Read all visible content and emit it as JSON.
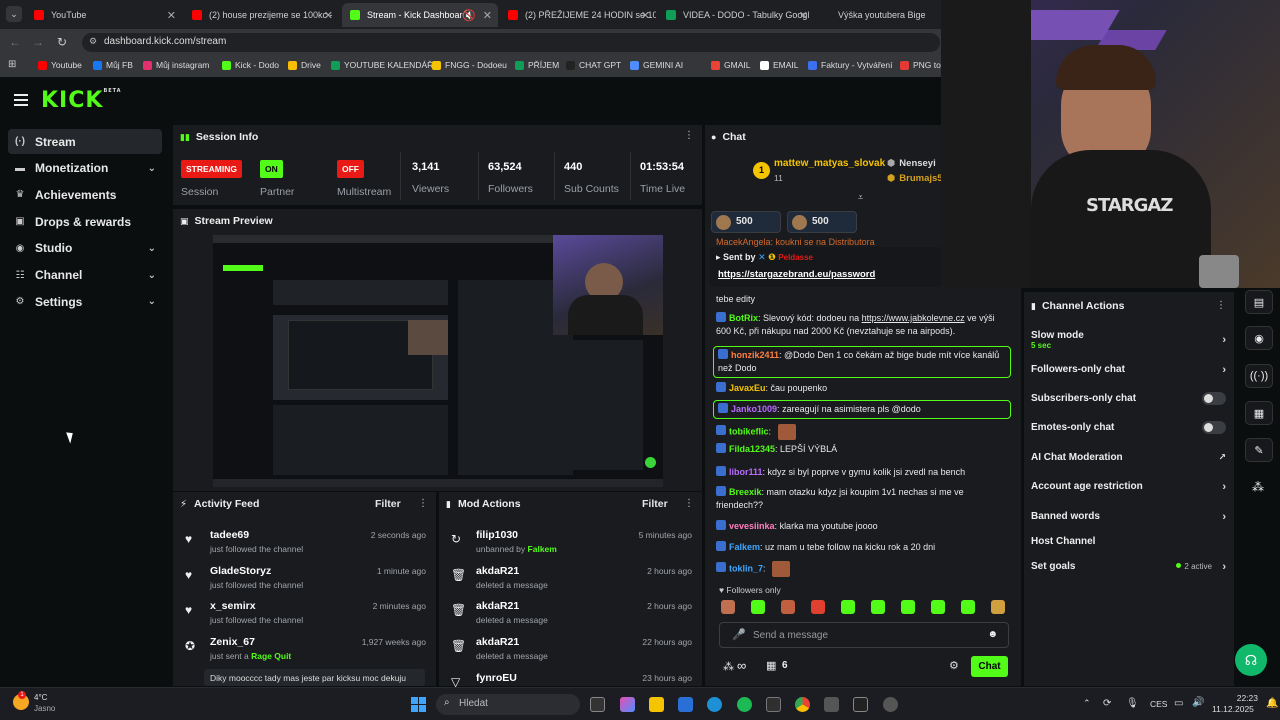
{
  "browser": {
    "tabs": [
      {
        "title": "YouTube",
        "color": "#ff0000"
      },
      {
        "title": "(2) house prezijeme se 100kc - ",
        "color": "#ff0000"
      },
      {
        "title": "Stream - Kick Dashboard",
        "color": "#53fc18"
      },
      {
        "title": "(2) PŘEŽIJEME 24 HODIN se 10",
        "color": "#ff0000"
      },
      {
        "title": "VIDEA - DODO - Tabulky Googl",
        "color": "#0f9d58"
      },
      {
        "title": "Výška youtubera Bige",
        "color": "#dddddd"
      }
    ],
    "url": "dashboard.kick.com/stream",
    "bookmarks": [
      {
        "label": "Youtube",
        "color": "#ff0000"
      },
      {
        "label": "Můj FB",
        "color": "#1877f2"
      },
      {
        "label": "Můj instagram",
        "color": "#e1306c"
      },
      {
        "label": "Kick - Dodo",
        "color": "#53fc18"
      },
      {
        "label": "Drive",
        "color": "#fbbc04"
      },
      {
        "label": "YOUTUBE KALENDÁŘ",
        "color": "#0f9d58"
      },
      {
        "label": "FNGG - Dodoeu",
        "color": "#f5c400"
      },
      {
        "label": "PŘÍJEM",
        "color": "#0f9d58"
      },
      {
        "label": "CHAT GPT",
        "color": "#222222"
      },
      {
        "label": "GEMINI AI",
        "color": "#4e8cff"
      },
      {
        "label": "GMAIL",
        "color": "#ea4335"
      },
      {
        "label": "EMAIL",
        "color": "#ffffff"
      },
      {
        "label": "Faktury - Vytváření",
        "color": "#3b6ff0"
      },
      {
        "label": "PNG to",
        "color": "#e53935"
      }
    ]
  },
  "app": {
    "logo": "KICK",
    "logo_sup": "BETA",
    "nav": [
      {
        "label": "Stream",
        "icon": "broadcast-icon",
        "glyph": "(·)",
        "chevron": false
      },
      {
        "label": "Monetization",
        "icon": "money-icon",
        "glyph": "▬",
        "chevron": true
      },
      {
        "label": "Achievements",
        "icon": "trophy-icon",
        "glyph": "♛",
        "chevron": false
      },
      {
        "label": "Drops & rewards",
        "icon": "gift-icon",
        "glyph": "▣",
        "chevron": false
      },
      {
        "label": "Studio",
        "icon": "studio-icon",
        "glyph": "◉",
        "chevron": true
      },
      {
        "label": "Channel",
        "icon": "channel-icon",
        "glyph": "☷",
        "chevron": true
      },
      {
        "label": "Settings",
        "icon": "gear-icon",
        "glyph": "⚙",
        "chevron": true
      }
    ],
    "session": {
      "title": "Session Info",
      "streaming_badge": "STREAMING",
      "streaming_label": "Session",
      "partner_badge": "ON",
      "partner_label": "Partner Income",
      "multistream_badge": "OFF",
      "multistream_label": "Multistream",
      "stats": [
        {
          "value": "3,141",
          "label": "Viewers"
        },
        {
          "value": "63,524",
          "label": "Followers"
        },
        {
          "value": "440",
          "label": "Sub Counts"
        },
        {
          "value": "01:53:54",
          "label": "Time Live"
        }
      ]
    },
    "preview": {
      "title": "Stream Preview"
    },
    "activity": {
      "title": "Activity Feed",
      "filter": "Filter",
      "items": [
        {
          "name": "tadee69",
          "sub": "just followed the channel",
          "time": "2 seconds ago",
          "icon": "heart-icon"
        },
        {
          "name": "GladeStoryz",
          "sub": "just followed the channel",
          "time": "1 minute ago",
          "icon": "heart-icon"
        },
        {
          "name": "x_semirx",
          "sub": "just followed the channel",
          "time": "2 minutes ago",
          "icon": "heart-icon"
        },
        {
          "name": "Zenix_67",
          "sub_prefix": "just sent a",
          "sub_highlight": "Rage Quit",
          "time": "1,927 weeks ago",
          "icon": "kick-coin-icon",
          "message": "Diky moocccc tady mas jeste par kicksu moc dekuju"
        }
      ]
    },
    "mod": {
      "title": "Mod Actions",
      "filter": "Filter",
      "items": [
        {
          "name": "filip1030",
          "sub_prefix": "unbanned by",
          "sub_highlight": "Falkem",
          "time": "5 minutes ago",
          "icon": "unban-icon"
        },
        {
          "name": "akdaR21",
          "sub": "deleted a message",
          "time": "2 hours ago",
          "icon": "trash-icon"
        },
        {
          "name": "akdaR21",
          "sub": "deleted a message",
          "time": "2 hours ago",
          "icon": "trash-icon"
        },
        {
          "name": "akdaR21",
          "sub": "deleted a message",
          "time": "22 hours ago",
          "icon": "trash-icon"
        },
        {
          "name": "fynroEU",
          "sub": "",
          "time": "23 hours ago",
          "icon": "timeout-icon"
        }
      ]
    },
    "chat": {
      "title": "Chat",
      "top_gifter": "mattew_matyas_slovak",
      "top_gifter_count": "11",
      "gifter_right_1": "Nenseyi",
      "gifter_right_2": "Brumajs5",
      "pinned_amounts": [
        "500",
        "500"
      ],
      "pinned_partial": "MacekAngela: koukni se na Distributora",
      "pinned_sent_by": "Sent by",
      "pinned_user": "Peldasse",
      "pinned_link": "https://stargazebrand.eu/password",
      "tebe_edity": "tebe edity",
      "messages": [
        {
          "user": "BotRix",
          "color": "#53fc18",
          "text": "Slevový kód: dodoeu na ",
          "link": "https://www.jabkolevne.cz",
          "text2": " ve výši 600 Kč, při nákupu nad 2000 Kč (nevztahuje se na airpods).",
          "boxed": false
        },
        {
          "user": "honzik2411",
          "color": "#ff7f3f",
          "text": "@Dodo Den 1 co čekám až bige bude mít více kanálů než Dodo",
          "boxed": true
        },
        {
          "user": "JavaxEu",
          "color": "#f5c400",
          "text": "čau poupenko",
          "boxed": false
        },
        {
          "user": "Janko1009",
          "color": "#b96bff",
          "text": "zareagují na asimistera pls @dodo",
          "boxed": true
        },
        {
          "user": "tobikeflic",
          "color": "#53fc18",
          "text": "",
          "boxed": false
        },
        {
          "user": "Filda12345",
          "color": "#53fc18",
          "text": "LEPŠÍ VÝBLÁ",
          "boxed": false
        },
        {
          "user": "libor111",
          "color": "#b96bff",
          "text": "kdyz si byl poprve v gymu kolik jsi zvedl na bench",
          "boxed": false
        },
        {
          "user": "Breexik",
          "color": "#53fc18",
          "text": "mam otazku kdyz jsi koupim 1v1 nechas si me ve friendech??",
          "boxed": false
        },
        {
          "user": "vevesiinka",
          "color": "#ff7fbf",
          "text": "klarka ma youtube joooo",
          "boxed": false
        },
        {
          "user": "Falkem",
          "color": "#3ea6ff",
          "text": "uz mam u tebe follow na kicku rok a 20 dni",
          "boxed": false
        },
        {
          "user": "toklin_7",
          "color": "#3ea6ff",
          "text": "",
          "boxed": false
        }
      ],
      "followers_only": "Followers only",
      "input_placeholder": "Send a message",
      "infinity": "∞",
      "gift_count": "6",
      "send_label": "Chat"
    },
    "channel_actions": {
      "title": "Channel Actions",
      "items": [
        {
          "label": "Slow mode",
          "sub": "5 sec",
          "control": "arrow"
        },
        {
          "label": "Followers-only chat",
          "control": "arrow"
        },
        {
          "label": "Subscribers-only chat",
          "control": "toggle"
        },
        {
          "label": "Emotes-only chat",
          "control": "toggle"
        },
        {
          "label": "AI Chat Moderation",
          "control": "external"
        },
        {
          "label": "Account age restriction",
          "control": "arrow"
        },
        {
          "label": "Banned words",
          "control": "arrow"
        },
        {
          "label": "Host Channel",
          "control": "none"
        },
        {
          "label": "Set goals",
          "control": "arrow",
          "extra": "2 active"
        }
      ]
    }
  },
  "taskbar": {
    "weather_temp": "4°C",
    "weather_desc": "Jasno",
    "weather_badge": "1",
    "search_placeholder": "Hledat",
    "lang": "CES",
    "time": "22:23",
    "date": "11.12.2025"
  },
  "colors": {
    "kick_green": "#53fc18",
    "live_red": "#e91916"
  }
}
